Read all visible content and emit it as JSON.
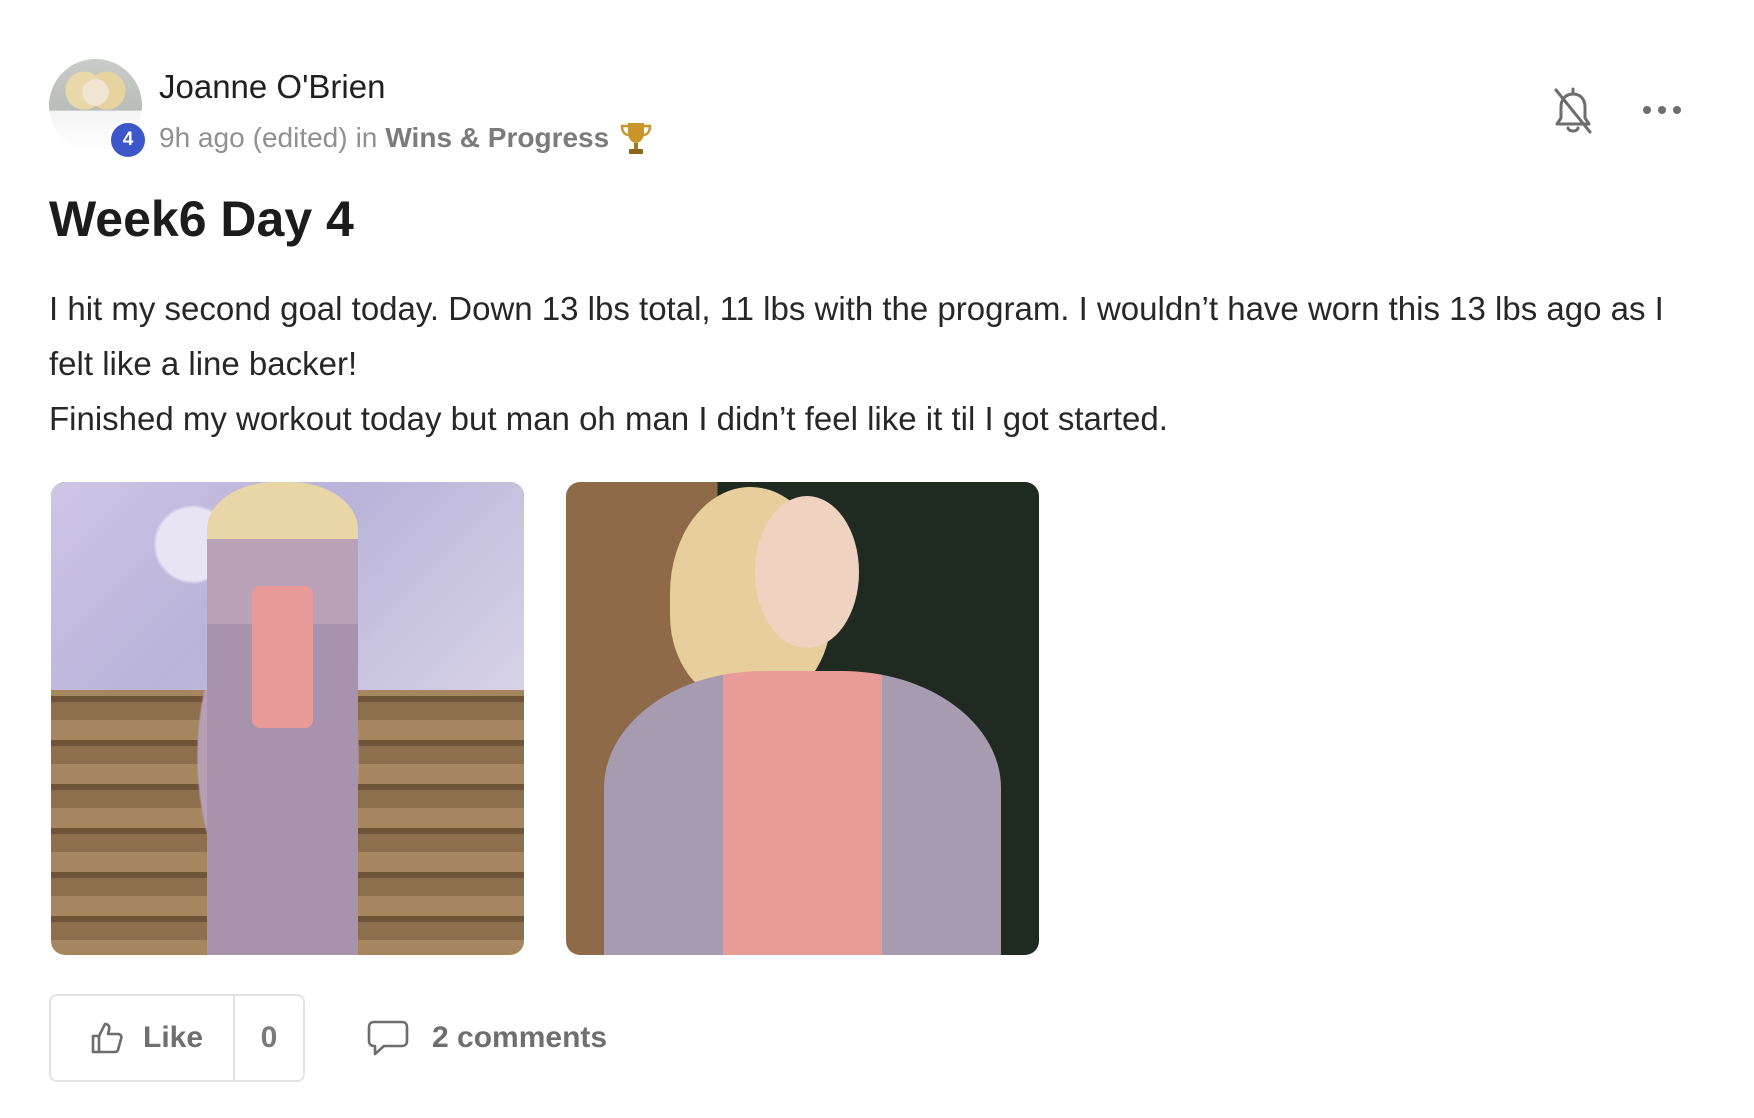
{
  "post": {
    "author": {
      "name": "Joanne O'Brien",
      "level": "4"
    },
    "meta": {
      "time": "9h ago",
      "edited": "(edited)",
      "in_label": "in",
      "category": "Wins & Progress",
      "category_icon": "trophy-icon"
    },
    "controls": {
      "notify_icon": "bell-off-icon",
      "more_icon": "more-horizontal-icon"
    },
    "title": "Week6 Day 4",
    "body": [
      "I hit my second goal today. Down 13 lbs total, 11 lbs with the program. I wouldn’t have worn this 13 lbs ago as I felt like a line backer!",
      "Finished my workout today but man oh man I didn’t feel like it til I got started."
    ],
    "actions": {
      "like_label": "Like",
      "like_count": "0",
      "like_icon": "thumbs-up-icon",
      "comments_label": "2 comments",
      "comments_icon": "chat-bubble-icon"
    },
    "colors": {
      "level_badge": "#3c57c9",
      "trophy": "#c9962a"
    }
  }
}
